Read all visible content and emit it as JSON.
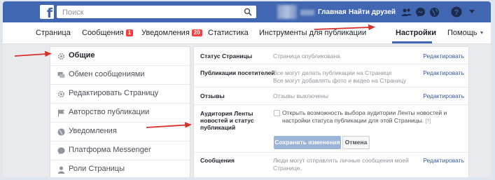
{
  "topbar": {
    "logo": "f",
    "search_placeholder": "Поиск",
    "link_home": "Главная",
    "link_find_friends": "Найти друзей"
  },
  "pagenav": {
    "items": [
      {
        "label": "Страница"
      },
      {
        "label": "Сообщения",
        "badge": "1"
      },
      {
        "label": "Уведомления",
        "badge": "20"
      },
      {
        "label": "Статистика"
      },
      {
        "label": "Инструменты для публикации"
      },
      {
        "label": "Настройки"
      },
      {
        "label": "Помощь"
      }
    ],
    "active": "Настройки"
  },
  "leftmenu": {
    "items": [
      {
        "label": "Общие",
        "icon": "gear-icon",
        "active": true
      },
      {
        "label": "Обмен сообщениями",
        "icon": "chat-bubble-icon"
      },
      {
        "label": "Редактировать Страницу",
        "icon": "gear-icon"
      },
      {
        "label": "Авторство публикации",
        "icon": "flag-icon"
      },
      {
        "label": "Уведомления",
        "icon": "globe-icon"
      },
      {
        "label": "Платформа Messenger",
        "icon": "messenger-icon"
      },
      {
        "label": "Роли Страницы",
        "icon": "person-icon"
      }
    ]
  },
  "settings": {
    "rows": [
      {
        "label": "Статус Страницы",
        "value": "Страница опубликована",
        "edit": "Редактировать"
      },
      {
        "label": "Публикации посетителей",
        "value_line1": "Все могут делать публикации на Странице",
        "value_line2": "Все могут добавлять фото и видео на Страницу",
        "edit": "Редактировать"
      },
      {
        "label": "Отзывы",
        "value": "Отзывы выключены",
        "edit": "Редактировать"
      },
      {
        "label_line1": "Аудитория Ленты",
        "label_line2": "новостей и статус",
        "label_line3": "публикаций",
        "checkbox_text_line1": "Открыть возможность выбора аудитории Ленты новостей и",
        "checkbox_text_line2": "настройки статуса публикации для этой Страницы.",
        "help": "[?]",
        "checked": false,
        "save_label": "Сохранить изменения",
        "cancel_label": "Отмена"
      },
      {
        "label": "Сообщения",
        "value_line1": "Люди могут отправлять личные сообщения моей",
        "value_line2": "Странице.",
        "edit": "Редактировать"
      }
    ]
  },
  "colors": {
    "brand_blue": "#4267b2",
    "link_blue": "#365899",
    "annotation_red": "#d9302b",
    "badge_red": "#fa3e3e"
  }
}
